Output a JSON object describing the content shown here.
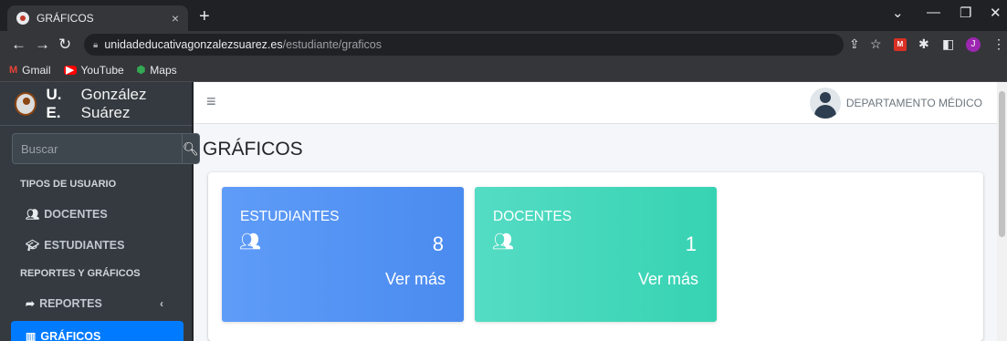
{
  "browser": {
    "tab_title": "GRÁFICOS",
    "tab_close": "×",
    "new_tab": "+",
    "url_host": "unidadeducativagonzalezsuarez.es",
    "url_path": "/estudiante/graficos",
    "profile_initial": "J",
    "ext_label": "M",
    "bookmarks": [
      {
        "icon": "gmail-icon",
        "glyph": "M",
        "label": "Gmail"
      },
      {
        "icon": "youtube-icon",
        "glyph": "▶",
        "label": "YouTube"
      },
      {
        "icon": "maps-icon",
        "glyph": "⬢",
        "label": "Maps"
      }
    ]
  },
  "brand": {
    "bold": "U. E.",
    "name": "González Suárez"
  },
  "search": {
    "placeholder": "Buscar"
  },
  "sidebar": {
    "header_users": "TIPOS DE USUARIO",
    "header_reports": "REPORTES Y GRÁFICOS",
    "items": [
      {
        "label": "DOCENTES",
        "icon": "chalkboard-teacher-icon"
      },
      {
        "label": "ESTUDIANTES",
        "icon": "user-graduate-icon"
      },
      {
        "label": "REPORTES",
        "icon": "share-arrow-icon"
      },
      {
        "label": "GRÁFICOS",
        "icon": "chart-bar-icon"
      }
    ]
  },
  "topnav": {
    "user_label": "DEPARTAMENTO MÉDICO"
  },
  "page": {
    "title": "GRÁFICOS"
  },
  "stats": [
    {
      "label": "ESTUDIANTES",
      "count": "8",
      "more": "Ver más",
      "color": "#4e8ff0"
    },
    {
      "label": "DOCENTES",
      "count": "1",
      "more": "Ver más",
      "color": "#3dd5b6"
    }
  ],
  "colors": {
    "sidebar_bg": "#343a40",
    "active_item": "#007bff"
  }
}
